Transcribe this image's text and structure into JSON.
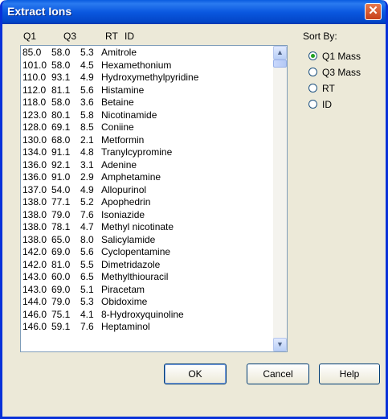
{
  "window": {
    "title": "Extract Ions",
    "close_symbol": "✕"
  },
  "list": {
    "headers": {
      "q1": "Q1",
      "q3": "Q3",
      "rt": "RT",
      "id": "ID"
    },
    "rows": [
      {
        "q1": "85.0",
        "q3": "58.0",
        "rt": "5.3",
        "id": "Amitrole"
      },
      {
        "q1": "101.0",
        "q3": "58.0",
        "rt": "4.5",
        "id": "Hexamethonium"
      },
      {
        "q1": "110.0",
        "q3": "93.1",
        "rt": "4.9",
        "id": "Hydroxymethylpyridine"
      },
      {
        "q1": "112.0",
        "q3": "81.1",
        "rt": "5.6",
        "id": "Histamine"
      },
      {
        "q1": "118.0",
        "q3": "58.0",
        "rt": "3.6",
        "id": "Betaine"
      },
      {
        "q1": "123.0",
        "q3": "80.1",
        "rt": "5.8",
        "id": "Nicotinamide"
      },
      {
        "q1": "128.0",
        "q3": "69.1",
        "rt": "8.5",
        "id": "Coniine"
      },
      {
        "q1": "130.0",
        "q3": "68.0",
        "rt": "2.1",
        "id": "Metformin"
      },
      {
        "q1": "134.0",
        "q3": "91.1",
        "rt": "4.8",
        "id": "Tranylcypromine"
      },
      {
        "q1": "136.0",
        "q3": "92.1",
        "rt": "3.1",
        "id": "Adenine"
      },
      {
        "q1": "136.0",
        "q3": "91.0",
        "rt": "2.9",
        "id": "Amphetamine"
      },
      {
        "q1": "137.0",
        "q3": "54.0",
        "rt": "4.9",
        "id": "Allopurinol"
      },
      {
        "q1": "138.0",
        "q3": "77.1",
        "rt": "5.2",
        "id": "Apophedrin"
      },
      {
        "q1": "138.0",
        "q3": "79.0",
        "rt": "7.6",
        "id": "Isoniazide"
      },
      {
        "q1": "138.0",
        "q3": "78.1",
        "rt": "4.7",
        "id": "Methyl nicotinate"
      },
      {
        "q1": "138.0",
        "q3": "65.0",
        "rt": "8.0",
        "id": "Salicylamide"
      },
      {
        "q1": "142.0",
        "q3": "69.0",
        "rt": "5.6",
        "id": "Cyclopentamine"
      },
      {
        "q1": "142.0",
        "q3": "81.0",
        "rt": "5.5",
        "id": "Dimetridazole"
      },
      {
        "q1": "143.0",
        "q3": "60.0",
        "rt": "6.5",
        "id": "Methylthiouracil"
      },
      {
        "q1": "143.0",
        "q3": "69.0",
        "rt": "5.1",
        "id": "Piracetam"
      },
      {
        "q1": "144.0",
        "q3": "79.0",
        "rt": "5.3",
        "id": "Obidoxime"
      },
      {
        "q1": "146.0",
        "q3": "75.1",
        "rt": "4.1",
        "id": "8-Hydroxyquinoline"
      },
      {
        "q1": "146.0",
        "q3": "59.1",
        "rt": "7.6",
        "id": "Heptaminol"
      }
    ]
  },
  "sort": {
    "label": "Sort By:",
    "options": [
      {
        "label": "Q1 Mass",
        "checked": true
      },
      {
        "label": "Q3 Mass",
        "checked": false
      },
      {
        "label": "RT",
        "checked": false
      },
      {
        "label": "ID",
        "checked": false
      }
    ]
  },
  "buttons": {
    "ok": "OK",
    "cancel": "Cancel",
    "help": "Help"
  },
  "icons": {
    "scroll_up": "▲",
    "scroll_down": "▼"
  },
  "colors": {
    "title_bar": "#0a58e0",
    "dialog_bg": "#ece9d8",
    "close_button": "#c7401a"
  }
}
